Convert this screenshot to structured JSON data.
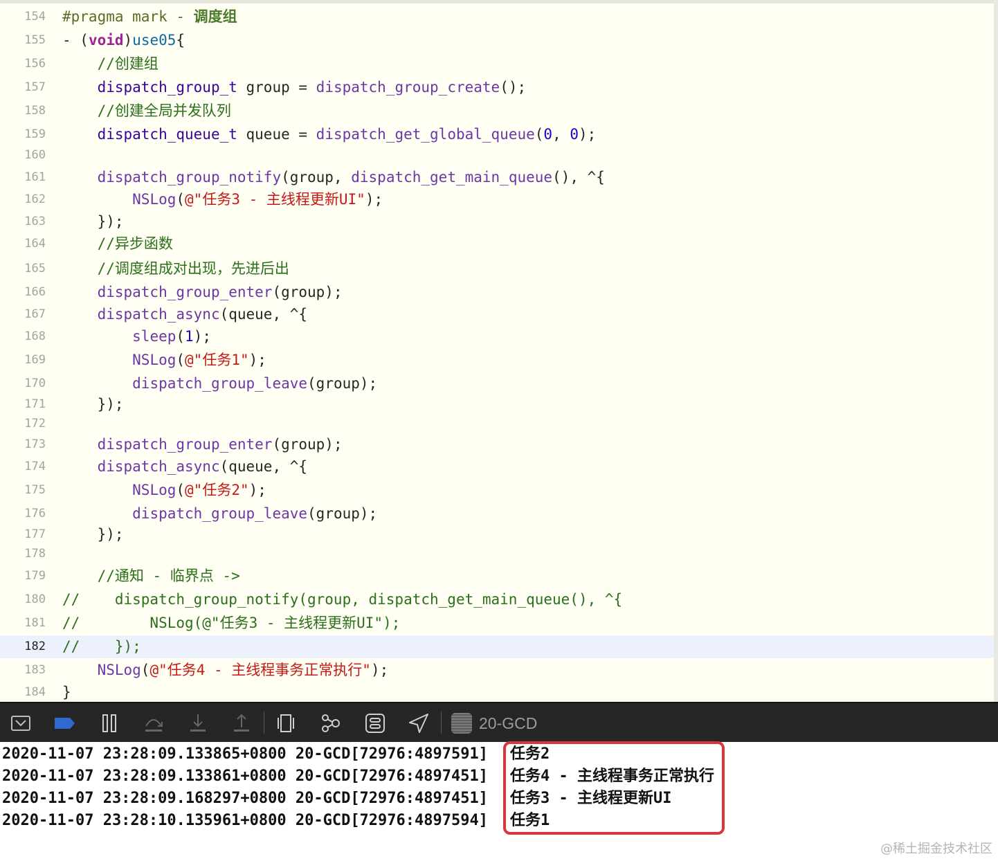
{
  "code_lines": [
    {
      "n": "154",
      "current": false,
      "tokens": [
        {
          "t": "#pragma mark - ",
          "c": "cm"
        },
        {
          "t": "调度组",
          "c": "cg"
        }
      ]
    },
    {
      "n": "155",
      "current": false,
      "tokens": [
        {
          "t": "- (",
          "c": ""
        },
        {
          "t": "void",
          "c": "kw"
        },
        {
          "t": ")",
          "c": ""
        },
        {
          "t": "use05",
          "c": "mt"
        },
        {
          "t": "{",
          "c": ""
        }
      ]
    },
    {
      "n": "156",
      "current": false,
      "tokens": [
        {
          "t": "    //创建组",
          "c": "cn"
        }
      ]
    },
    {
      "n": "157",
      "current": false,
      "tokens": [
        {
          "t": "    ",
          "c": ""
        },
        {
          "t": "dispatch_group_t",
          "c": "ty"
        },
        {
          "t": " group = ",
          "c": ""
        },
        {
          "t": "dispatch_group_create",
          "c": "fn"
        },
        {
          "t": "();",
          "c": ""
        }
      ]
    },
    {
      "n": "158",
      "current": false,
      "tokens": [
        {
          "t": "    //创建全局并发队列",
          "c": "cn"
        }
      ]
    },
    {
      "n": "159",
      "current": false,
      "tokens": [
        {
          "t": "    ",
          "c": ""
        },
        {
          "t": "dispatch_queue_t",
          "c": "ty"
        },
        {
          "t": " queue = ",
          "c": ""
        },
        {
          "t": "dispatch_get_global_queue",
          "c": "fn"
        },
        {
          "t": "(",
          "c": ""
        },
        {
          "t": "0",
          "c": "num"
        },
        {
          "t": ", ",
          "c": ""
        },
        {
          "t": "0",
          "c": "num"
        },
        {
          "t": ");",
          "c": ""
        }
      ]
    },
    {
      "n": "160",
      "current": false,
      "tokens": []
    },
    {
      "n": "161",
      "current": false,
      "tokens": [
        {
          "t": "    ",
          "c": ""
        },
        {
          "t": "dispatch_group_notify",
          "c": "fn"
        },
        {
          "t": "(group, ",
          "c": ""
        },
        {
          "t": "dispatch_get_main_queue",
          "c": "fn"
        },
        {
          "t": "(), ^{",
          "c": ""
        }
      ]
    },
    {
      "n": "162",
      "current": false,
      "tokens": [
        {
          "t": "        ",
          "c": ""
        },
        {
          "t": "NSLog",
          "c": "fn"
        },
        {
          "t": "(",
          "c": ""
        },
        {
          "t": "@\"任务3 - 主线程更新UI\"",
          "c": "str"
        },
        {
          "t": ");",
          "c": ""
        }
      ]
    },
    {
      "n": "163",
      "current": false,
      "tokens": [
        {
          "t": "    });",
          "c": ""
        }
      ]
    },
    {
      "n": "164",
      "current": false,
      "tokens": [
        {
          "t": "    //异步函数",
          "c": "cn"
        }
      ]
    },
    {
      "n": "165",
      "current": false,
      "tokens": [
        {
          "t": "    //调度组成对出现，先进后出",
          "c": "cn"
        }
      ]
    },
    {
      "n": "166",
      "current": false,
      "tokens": [
        {
          "t": "    ",
          "c": ""
        },
        {
          "t": "dispatch_group_enter",
          "c": "fn"
        },
        {
          "t": "(group);",
          "c": ""
        }
      ]
    },
    {
      "n": "167",
      "current": false,
      "tokens": [
        {
          "t": "    ",
          "c": ""
        },
        {
          "t": "dispatch_async",
          "c": "fn"
        },
        {
          "t": "(queue, ^{",
          "c": ""
        }
      ]
    },
    {
      "n": "168",
      "current": false,
      "tokens": [
        {
          "t": "        ",
          "c": ""
        },
        {
          "t": "sleep",
          "c": "fn"
        },
        {
          "t": "(",
          "c": ""
        },
        {
          "t": "1",
          "c": "num"
        },
        {
          "t": ");",
          "c": ""
        }
      ]
    },
    {
      "n": "169",
      "current": false,
      "tokens": [
        {
          "t": "        ",
          "c": ""
        },
        {
          "t": "NSLog",
          "c": "fn"
        },
        {
          "t": "(",
          "c": ""
        },
        {
          "t": "@\"任务1\"",
          "c": "str"
        },
        {
          "t": ");",
          "c": ""
        }
      ]
    },
    {
      "n": "170",
      "current": false,
      "tokens": [
        {
          "t": "        ",
          "c": ""
        },
        {
          "t": "dispatch_group_leave",
          "c": "fn"
        },
        {
          "t": "(group);",
          "c": ""
        }
      ]
    },
    {
      "n": "171",
      "current": false,
      "tokens": [
        {
          "t": "    });",
          "c": ""
        }
      ]
    },
    {
      "n": "172",
      "current": false,
      "tokens": []
    },
    {
      "n": "173",
      "current": false,
      "tokens": [
        {
          "t": "    ",
          "c": ""
        },
        {
          "t": "dispatch_group_enter",
          "c": "fn"
        },
        {
          "t": "(group);",
          "c": ""
        }
      ]
    },
    {
      "n": "174",
      "current": false,
      "tokens": [
        {
          "t": "    ",
          "c": ""
        },
        {
          "t": "dispatch_async",
          "c": "fn"
        },
        {
          "t": "(queue, ^{",
          "c": ""
        }
      ]
    },
    {
      "n": "175",
      "current": false,
      "tokens": [
        {
          "t": "        ",
          "c": ""
        },
        {
          "t": "NSLog",
          "c": "fn"
        },
        {
          "t": "(",
          "c": ""
        },
        {
          "t": "@\"任务2\"",
          "c": "str"
        },
        {
          "t": ");",
          "c": ""
        }
      ]
    },
    {
      "n": "176",
      "current": false,
      "tokens": [
        {
          "t": "        ",
          "c": ""
        },
        {
          "t": "dispatch_group_leave",
          "c": "fn"
        },
        {
          "t": "(group);",
          "c": ""
        }
      ]
    },
    {
      "n": "177",
      "current": false,
      "tokens": [
        {
          "t": "    });",
          "c": ""
        }
      ]
    },
    {
      "n": "178",
      "current": false,
      "tokens": []
    },
    {
      "n": "179",
      "current": false,
      "tokens": [
        {
          "t": "    //通知 - 临界点 ->",
          "c": "cn"
        }
      ]
    },
    {
      "n": "180",
      "current": false,
      "tokens": [
        {
          "t": "//    dispatch_group_notify(group, dispatch_get_main_queue(), ^{",
          "c": "cn"
        }
      ]
    },
    {
      "n": "181",
      "current": false,
      "tokens": [
        {
          "t": "//        NSLog(@\"任务3 - 主线程更新UI\");",
          "c": "cn"
        }
      ]
    },
    {
      "n": "182",
      "current": true,
      "tokens": [
        {
          "t": "//    });",
          "c": "cn"
        }
      ]
    },
    {
      "n": "183",
      "current": false,
      "tokens": [
        {
          "t": "    ",
          "c": ""
        },
        {
          "t": "NSLog",
          "c": "fn"
        },
        {
          "t": "(",
          "c": ""
        },
        {
          "t": "@\"任务4 - 主线程事务正常执行\"",
          "c": "str"
        },
        {
          "t": ");",
          "c": ""
        }
      ]
    },
    {
      "n": "184",
      "current": false,
      "tokens": [
        {
          "t": "}",
          "c": ""
        }
      ]
    }
  ],
  "debug_toolbar": {
    "buttons": [
      {
        "name": "hide-debug-area-button",
        "icon": "panel-down-icon"
      },
      {
        "name": "breakpoints-toggle-button",
        "icon": "breakpoint-icon"
      },
      {
        "name": "pause-button",
        "icon": "pause-icon"
      },
      {
        "name": "step-over-button",
        "icon": "step-over-icon"
      },
      {
        "name": "step-into-button",
        "icon": "step-into-icon"
      },
      {
        "name": "step-out-button",
        "icon": "step-out-icon"
      },
      {
        "name": "view-debugger-button",
        "icon": "view-hierarchy-icon"
      },
      {
        "name": "memory-graph-button",
        "icon": "memory-graph-icon"
      },
      {
        "name": "environment-overrides-button",
        "icon": "environment-overrides-icon"
      },
      {
        "name": "simulate-location-button",
        "icon": "location-arrow-icon"
      }
    ],
    "scheme_name": "20-GCD"
  },
  "console": {
    "lines": [
      {
        "prefix": "2020-11-07 23:28:09.133865+0800 20-GCD[72976:4897591]",
        "message": "任务2"
      },
      {
        "prefix": "2020-11-07 23:28:09.133861+0800 20-GCD[72976:4897451]",
        "message": "任务4 - 主线程事务正常执行"
      },
      {
        "prefix": "2020-11-07 23:28:09.168297+0800 20-GCD[72976:4897451]",
        "message": "任务3 - 主线程更新UI"
      },
      {
        "prefix": "2020-11-07 23:28:10.135961+0800 20-GCD[72976:4897594]",
        "message": "任务1"
      }
    ],
    "highlight_color": "#d9363e"
  },
  "watermark": "@稀土掘金技术社区",
  "colors": {
    "editor_background": "#fffff3",
    "current_line": "#ecf1fb",
    "toolbar_background": "#262626",
    "breakpoint_active": "#2f6ad1"
  }
}
